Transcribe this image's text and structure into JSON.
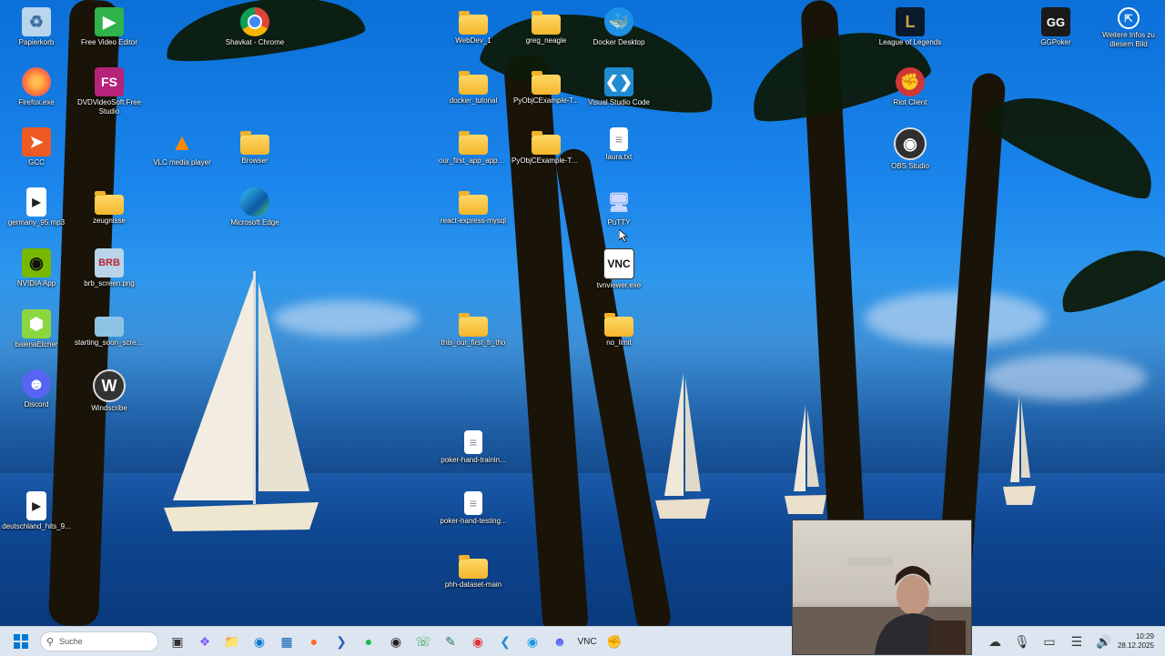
{
  "desktop_icons": [
    {
      "label": "Papierkorb",
      "icon": "recycle-bin-icon"
    },
    {
      "label": "Free Video Editor",
      "icon": "video-editor-icon"
    },
    {
      "label": "Shavkat - Chrome",
      "icon": "chrome-icon"
    },
    {
      "label": "WebDev_1",
      "icon": "folder-icon"
    },
    {
      "label": "greg_neagle",
      "icon": "folder-icon"
    },
    {
      "label": "Docker Desktop",
      "icon": "docker-icon"
    },
    {
      "label": "League of Legends",
      "icon": "league-icon"
    },
    {
      "label": "GGPoker",
      "icon": "ggpoker-icon"
    },
    {
      "label": "Weitere Infos zu diesem Bild",
      "icon": "info-icon"
    },
    {
      "label": "Firefox.exe",
      "icon": "firefox-icon"
    },
    {
      "label": "DVDVideoSoft Free Studio",
      "icon": "dvdvideosoft-icon"
    },
    {
      "label": "docker_tutorial",
      "icon": "folder-icon"
    },
    {
      "label": "PyObjCExample-T...",
      "icon": "folder-icon"
    },
    {
      "label": "Visual Studio Code",
      "icon": "vscode-icon"
    },
    {
      "label": "Riot Client",
      "icon": "riot-icon"
    },
    {
      "label": "GCC",
      "icon": "gcc-icon"
    },
    {
      "label": "VLC media player",
      "icon": "vlc-icon"
    },
    {
      "label": "Browser",
      "icon": "folder-icon"
    },
    {
      "label": "our_first_app_appar...",
      "icon": "folder-icon"
    },
    {
      "label": "PyObjCExample-Todo",
      "icon": "folder-icon"
    },
    {
      "label": "laura.txt",
      "icon": "text-file-icon"
    },
    {
      "label": "OBS Studio",
      "icon": "obs-icon"
    },
    {
      "label": "germany_95.mp3",
      "icon": "audio-file-icon"
    },
    {
      "label": "zeugnisse",
      "icon": "folder-icon"
    },
    {
      "label": "Microsoft Edge",
      "icon": "edge-icon"
    },
    {
      "label": "react-express-mysql",
      "icon": "folder-icon"
    },
    {
      "label": "PuTTY",
      "icon": "putty-icon"
    },
    {
      "label": "NVIDIA App",
      "icon": "nvidia-icon"
    },
    {
      "label": "brb_screen.png",
      "icon": "image-file-icon"
    },
    {
      "label": "tvnviewer.exe",
      "icon": "vnc-icon"
    },
    {
      "label": "balenaEtcher",
      "icon": "balena-icon"
    },
    {
      "label": "starting_soon_scree...",
      "icon": "image-file-icon"
    },
    {
      "label": "this_our_first_fr_tho",
      "icon": "folder-icon"
    },
    {
      "label": "no_limit",
      "icon": "folder-icon"
    },
    {
      "label": "Discord",
      "icon": "discord-icon"
    },
    {
      "label": "Windscribe",
      "icon": "windscribe-icon"
    },
    {
      "label": "poker-hand-trainin...",
      "icon": "text-file-icon"
    },
    {
      "label": "deutschland_hits_9...",
      "icon": "audio-file-icon"
    },
    {
      "label": "poker-hand-testing...",
      "icon": "text-file-icon"
    },
    {
      "label": "phh-dataset-main",
      "icon": "folder-icon"
    }
  ],
  "taskbar": {
    "search_placeholder": "Suche",
    "apps": [
      "task-view-icon",
      "copilot-icon",
      "file-explorer-icon",
      "edge-icon",
      "store-icon",
      "firefox-icon",
      "terminal-icon",
      "spotify-icon",
      "obs-icon",
      "whatsapp-icon",
      "notepad-icon",
      "chrome-icon",
      "vscode-icon",
      "edge-alt-icon",
      "discord-icon",
      "vnc-icon",
      "riot-icon"
    ],
    "time": "10:29",
    "date": "28.12.2025"
  },
  "colors": {
    "taskbar": "#dde6f0",
    "accent": "#0078d4"
  }
}
